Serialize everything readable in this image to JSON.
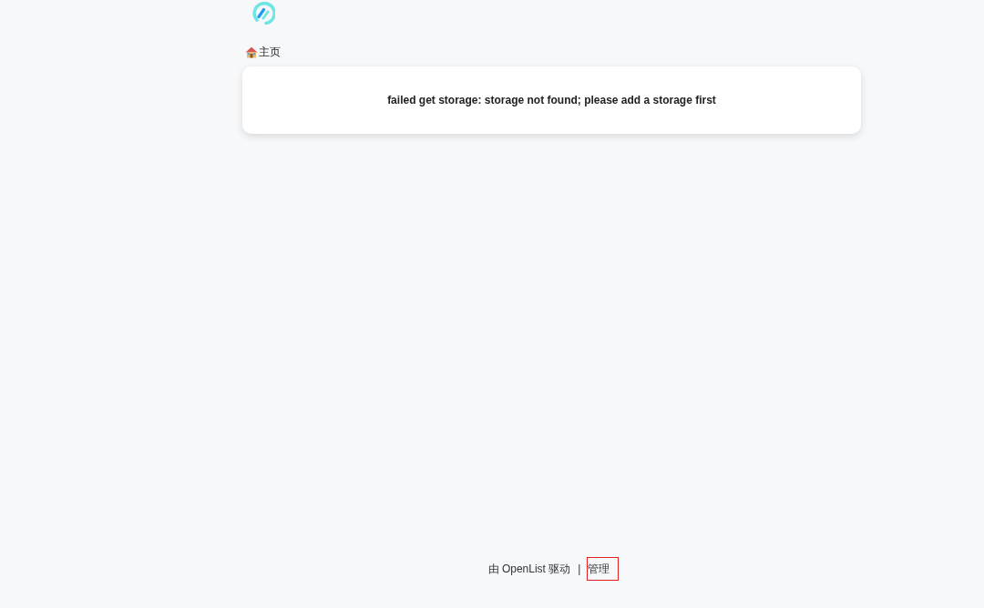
{
  "breadcrumb": [
    {
      "label": "主页",
      "kind": "home"
    }
  ],
  "message": {
    "text": "failed get storage: storage not found; please add a storage first"
  },
  "footer": {
    "powered_prefix": "由",
    "powered_link": "OpenList",
    "powered_suffix": "驱动",
    "separator": "|",
    "admin_link": {
      "label": "管理",
      "highlighted": true
    }
  }
}
